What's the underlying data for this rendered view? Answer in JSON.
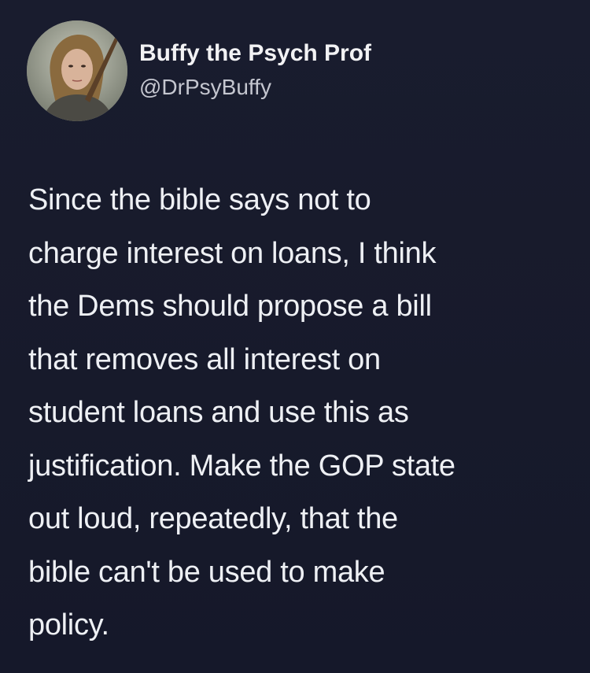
{
  "author": {
    "display_name": "Buffy the Psych Prof",
    "handle": "@DrPsyBuffy",
    "avatar_icon": "profile-photo-avatar"
  },
  "tweet": {
    "text": "Since the bible says not to\ncharge interest on loans, I think\nthe Dems should propose a bill\nthat removes all interest on\nstudent loans and use this as\njustification. Make the GOP state\nout loud, repeatedly, that the\nbible can't be used to make\npolicy."
  },
  "colors": {
    "background": "#171a2b",
    "name_text": "#f2f2f4",
    "handle_text": "#c4c6cf",
    "body_text": "#eef0f4"
  }
}
